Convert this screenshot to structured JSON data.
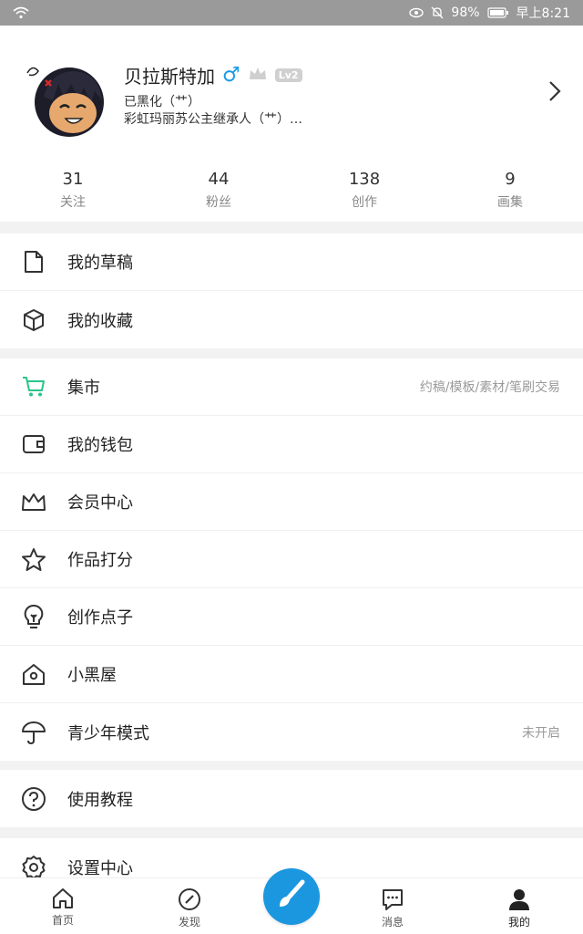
{
  "status_bar": {
    "battery": "98%",
    "time": "早上8:21"
  },
  "profile": {
    "name": "贝拉斯特加",
    "gender_symbol": "♂",
    "level": "Lv2",
    "tagline1": "已黑化（艹）",
    "tagline2": "彩虹玛丽苏公主继承人（艹）…"
  },
  "stats": [
    {
      "value": "31",
      "label": "关注"
    },
    {
      "value": "44",
      "label": "粉丝"
    },
    {
      "value": "138",
      "label": "创作"
    },
    {
      "value": "9",
      "label": "画集"
    }
  ],
  "menu": {
    "drafts": "我的草稿",
    "favorites": "我的收藏",
    "market": "集市",
    "market_hint": "约稿/模板/素材/笔刷交易",
    "wallet": "我的钱包",
    "vip": "会员中心",
    "rating": "作品打分",
    "ideas": "创作点子",
    "house": "小黑屋",
    "youth": "青少年模式",
    "youth_hint": "未开启",
    "tutorial": "使用教程",
    "settings": "设置中心"
  },
  "tabs": {
    "home": "首页",
    "discover": "发现",
    "messages": "消息",
    "mine": "我的"
  },
  "colors": {
    "accent": "#1b97e0",
    "market_icon": "#2bc48a",
    "gender": "#1a9be6"
  }
}
